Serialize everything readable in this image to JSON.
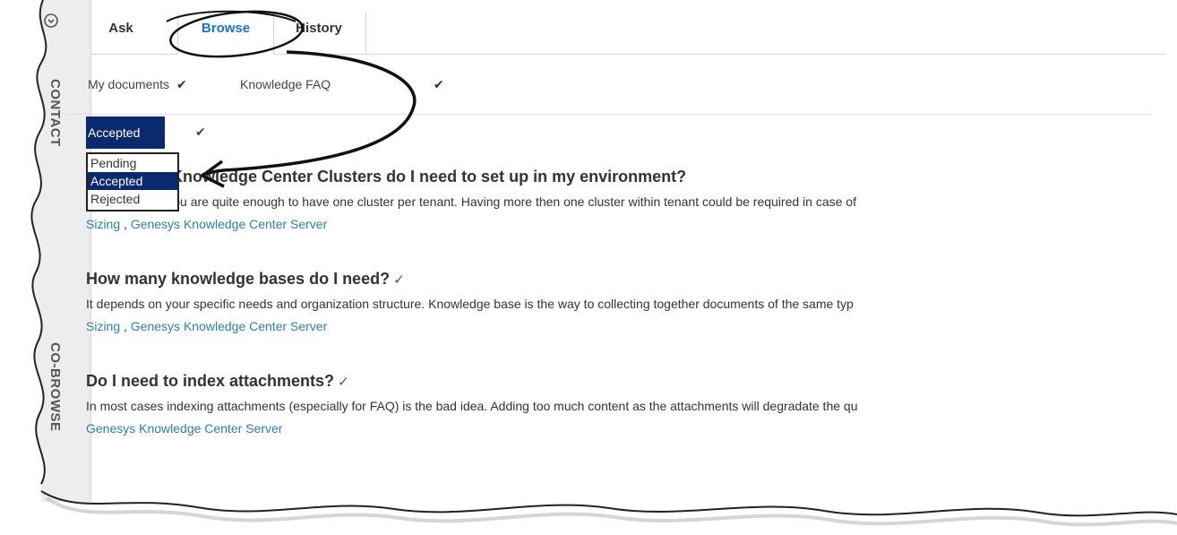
{
  "rail": {
    "contact_label": "CONTACT",
    "cobrowse_label": "CO-BROWSE"
  },
  "tabs": [
    {
      "label": "Ask"
    },
    {
      "label": "Browse"
    },
    {
      "label": "History"
    }
  ],
  "filters": {
    "scope": "My documents",
    "knowledge_base": "Knowledge FAQ"
  },
  "status": {
    "selected": "Accepted",
    "options": [
      "Pending",
      "Accepted",
      "Rejected"
    ]
  },
  "results": [
    {
      "question": "How many Knowledge Center Clusters do I need to set up in my environment?",
      "answer": "In most cases you are quite enough to have one cluster per tenant. Having more then one cluster within tenant could be required in case of",
      "tags": [
        "Sizing",
        "Genesys Knowledge Center Server"
      ]
    },
    {
      "question": "How many knowledge bases do I need?",
      "answer": "It depends on your specific needs and organization structure. Knowledge base is the way to collecting together documents of the same typ",
      "tags": [
        "Sizing",
        "Genesys Knowledge Center Server"
      ]
    },
    {
      "question": "Do I need to index attachments?",
      "answer": "In most cases indexing attachments (especially for FAQ) is the bad idea. Adding too much content as the attachments will degradate the qu",
      "tags": [
        "Genesys Knowledge Center Server"
      ]
    }
  ],
  "colors": {
    "accent": "#1a74c7",
    "selected_bg": "#0b2a6e",
    "tag_link": "#2e7fa6",
    "rail_bg": "#ededed"
  },
  "icons": {
    "rail_top": "circle-arrow-icon",
    "answer_mark": "checkmark-icon"
  }
}
